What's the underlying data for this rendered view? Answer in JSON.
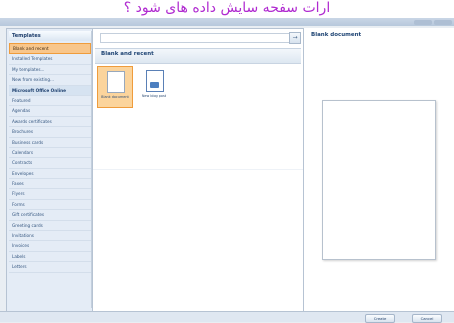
{
  "caption": {
    "text": "ارات سفحه سایش داده های شود ؟"
  },
  "sidebar": {
    "header": "Templates",
    "items": [
      {
        "label": "Blank and recent",
        "state": "selected"
      },
      {
        "label": "Installed Templates",
        "state": "normal"
      },
      {
        "label": "My templates...",
        "state": "normal"
      },
      {
        "label": "New from existing...",
        "state": "normal"
      },
      {
        "label": "Microsoft Office Online",
        "state": "bold"
      },
      {
        "label": "Featured",
        "state": "normal"
      },
      {
        "label": "Agendas",
        "state": "normal"
      },
      {
        "label": "Awards certificates",
        "state": "normal"
      },
      {
        "label": "Brochures",
        "state": "normal"
      },
      {
        "label": "Business cards",
        "state": "normal"
      },
      {
        "label": "Calendars",
        "state": "normal"
      },
      {
        "label": "Contracts",
        "state": "normal"
      },
      {
        "label": "Envelopes",
        "state": "normal"
      },
      {
        "label": "Faxes",
        "state": "normal"
      },
      {
        "label": "Flyers",
        "state": "normal"
      },
      {
        "label": "Forms",
        "state": "normal"
      },
      {
        "label": "Gift certificates",
        "state": "normal"
      },
      {
        "label": "Greeting cards",
        "state": "normal"
      },
      {
        "label": "Invitations",
        "state": "normal"
      },
      {
        "label": "Invoices",
        "state": "normal"
      },
      {
        "label": "Labels",
        "state": "normal"
      },
      {
        "label": "Letters",
        "state": "normal"
      }
    ]
  },
  "middle": {
    "section_title": "Blank and recent",
    "templates": [
      {
        "label": "Blank document"
      },
      {
        "label": "New blog post"
      }
    ]
  },
  "preview": {
    "title": "Blank document"
  },
  "footer": {
    "create_label": "Create",
    "cancel_label": "Cancel"
  },
  "colors": {
    "caption_text": "#b02ad0",
    "selection_fill": "#fbd49c",
    "selection_border": "#ef9c3c",
    "header_text": "#1c4272"
  }
}
